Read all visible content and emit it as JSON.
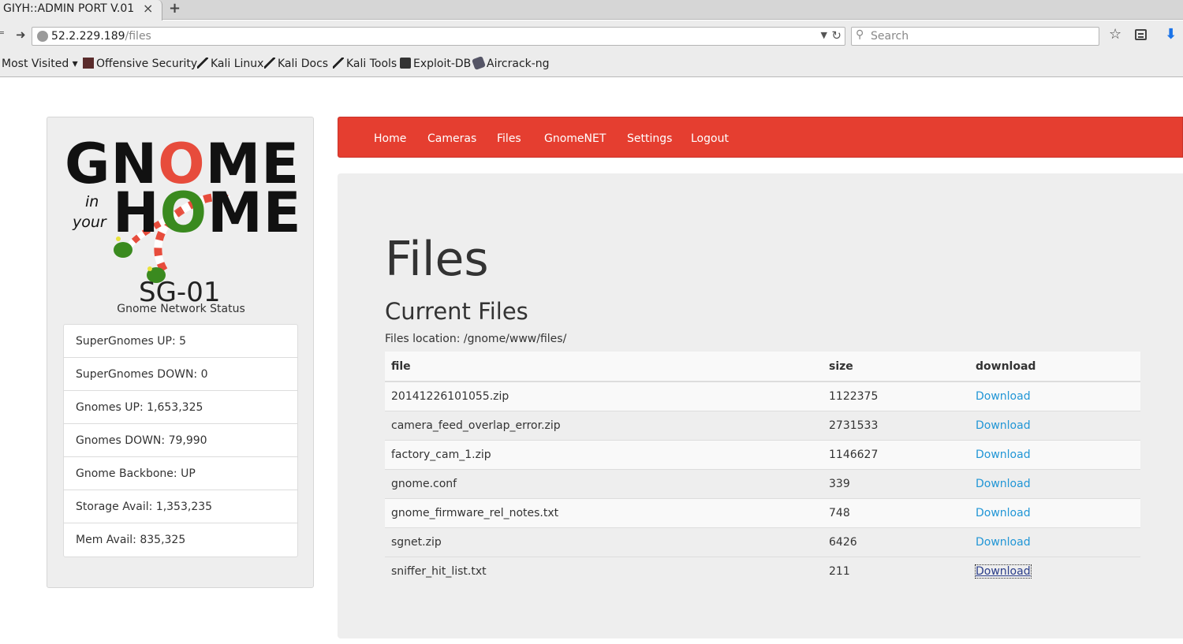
{
  "browser": {
    "tab_title": "GIYH::ADMIN PORT V.01",
    "tab_close": "×",
    "new_tab": "+",
    "url_host": "52.2.229.189",
    "url_path": "/files",
    "search_placeholder": "Search",
    "bookmarks": [
      {
        "label": "Most Visited ▾",
        "icon": "none"
      },
      {
        "label": "Offensive Security",
        "icon": "offensive-security-icon"
      },
      {
        "label": "Kali Linux",
        "icon": "kali-dragon-icon"
      },
      {
        "label": "Kali Docs",
        "icon": "kali-dragon-icon"
      },
      {
        "label": "Kali Tools",
        "icon": "kali-dragon-icon"
      },
      {
        "label": "Exploit-DB",
        "icon": "exploit-db-icon"
      },
      {
        "label": "Aircrack-ng",
        "icon": "aircrack-icon"
      }
    ]
  },
  "sidebar": {
    "logo_line1": "GNOME",
    "logo_in": "in",
    "logo_your": "your",
    "logo_line2": "HOME",
    "logo_code": "SG-01",
    "status_title": "Gnome Network Status",
    "status_items": [
      "SuperGnomes UP: 5",
      "SuperGnomes DOWN: 0",
      "Gnomes UP: 1,653,325",
      "Gnomes DOWN: 79,990",
      "Gnome Backbone: UP",
      "Storage Avail: 1,353,235",
      "Mem Avail: 835,325"
    ]
  },
  "nav": {
    "items": [
      "Home",
      "Cameras",
      "Files",
      "GnomeNET",
      "Settings",
      "Logout"
    ]
  },
  "main": {
    "title": "Files",
    "subtitle": "Current Files",
    "location": "Files location: /gnome/www/files/",
    "headers": {
      "file": "file",
      "size": "size",
      "download": "download"
    },
    "rows": [
      {
        "file": "20141226101055.zip",
        "size": "1122375",
        "download": "Download"
      },
      {
        "file": "camera_feed_overlap_error.zip",
        "size": "2731533",
        "download": "Download"
      },
      {
        "file": "factory_cam_1.zip",
        "size": "1146627",
        "download": "Download"
      },
      {
        "file": "gnome.conf",
        "size": "339",
        "download": "Download"
      },
      {
        "file": "gnome_firmware_rel_notes.txt",
        "size": "748",
        "download": "Download"
      },
      {
        "file": "sgnet.zip",
        "size": "6426",
        "download": "Download"
      },
      {
        "file": "sniffer_hit_list.txt",
        "size": "211",
        "download": "Download"
      }
    ]
  },
  "colors": {
    "nav_red": "#e53e30",
    "link_blue": "#2196d6",
    "logo_red": "#e74c3c",
    "logo_green": "#3a8a1f"
  }
}
